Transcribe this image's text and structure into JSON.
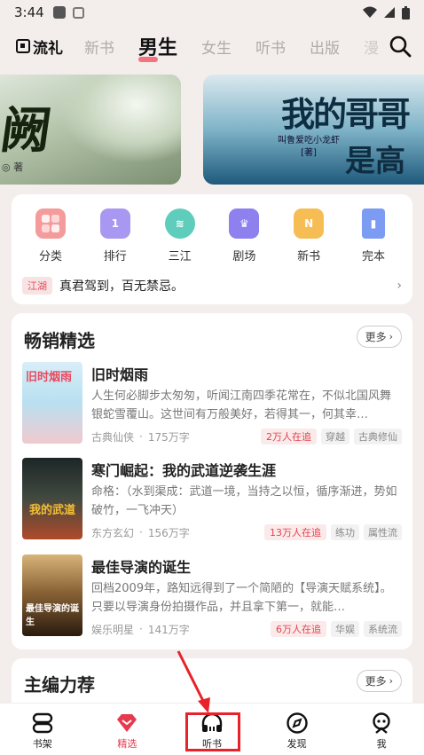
{
  "status": {
    "time": "3:44"
  },
  "nav": {
    "logo": "流礼",
    "tabs": [
      "新书",
      "男生",
      "女生",
      "听书",
      "出版",
      "漫"
    ]
  },
  "banners": [
    {
      "title": "阙",
      "author": "◎ 著"
    },
    {
      "title_line1": "我的哥哥",
      "title_line2": "是高",
      "subtitle_line1": "叫鲁爱吃小龙虾",
      "subtitle_line2": "[著]"
    }
  ],
  "categories": [
    {
      "label": "分类",
      "icon": "grid-icon",
      "color": "#f08a8a"
    },
    {
      "label": "排行",
      "icon": "rank-icon",
      "color": "#9e8cf0"
    },
    {
      "label": "三江",
      "icon": "wave-icon",
      "color": "#49c3b0"
    },
    {
      "label": "剧场",
      "icon": "theater-icon",
      "color": "#8a7cf0"
    },
    {
      "label": "新书",
      "icon": "new-book-icon",
      "color": "#f5b54a"
    },
    {
      "label": "完本",
      "icon": "finished-book-icon",
      "color": "#6f8ff0"
    }
  ],
  "notice": {
    "tag": "江湖",
    "text": "真君驾到，百无禁忌。"
  },
  "bestseller": {
    "title": "畅销精选",
    "more": "更多",
    "books": [
      {
        "title": "旧时烟雨",
        "cover_title": "旧时烟雨",
        "desc": "人生何必脚步太匆匆，听闻江南四季花常在，不似北国风舞银蛇雪覆山。这世间有万般美好，若得其一，何其幸…",
        "genre": "古典仙侠",
        "words": "175万字",
        "hot": "2万人在追",
        "tags": [
          "穿越",
          "古典修仙"
        ]
      },
      {
        "title": "寒门崛起：我的武道逆袭生涯",
        "cover_title": "我的武道",
        "desc": "命格：（水到渠成：武道一境，当持之以恒，循序渐进，势如破竹，一飞冲天）",
        "genre": "东方玄幻",
        "words": "156万字",
        "hot": "13万人在追",
        "tags": [
          "练功",
          "属性流"
        ]
      },
      {
        "title": "最佳导演的诞生",
        "cover_title": "最佳导演的诞生",
        "desc": "回档2009年，路知远得到了一个简陋的【导演天赋系统】。只要以导演身份拍摄作品，并且拿下第一，就能…",
        "genre": "娱乐明星",
        "words": "141万字",
        "hot": "6万人在追",
        "tags": [
          "华娱",
          "系统流"
        ]
      }
    ]
  },
  "editor_pick": {
    "title": "主编力荐",
    "more": "更多"
  },
  "bottom_nav": [
    {
      "label": "书架",
      "icon": "bookshelf-icon"
    },
    {
      "label": "精选",
      "icon": "diamond-icon",
      "active": true
    },
    {
      "label": "听书",
      "icon": "headphones-icon"
    },
    {
      "label": "发现",
      "icon": "compass-icon"
    },
    {
      "label": "我",
      "icon": "profile-icon"
    }
  ]
}
